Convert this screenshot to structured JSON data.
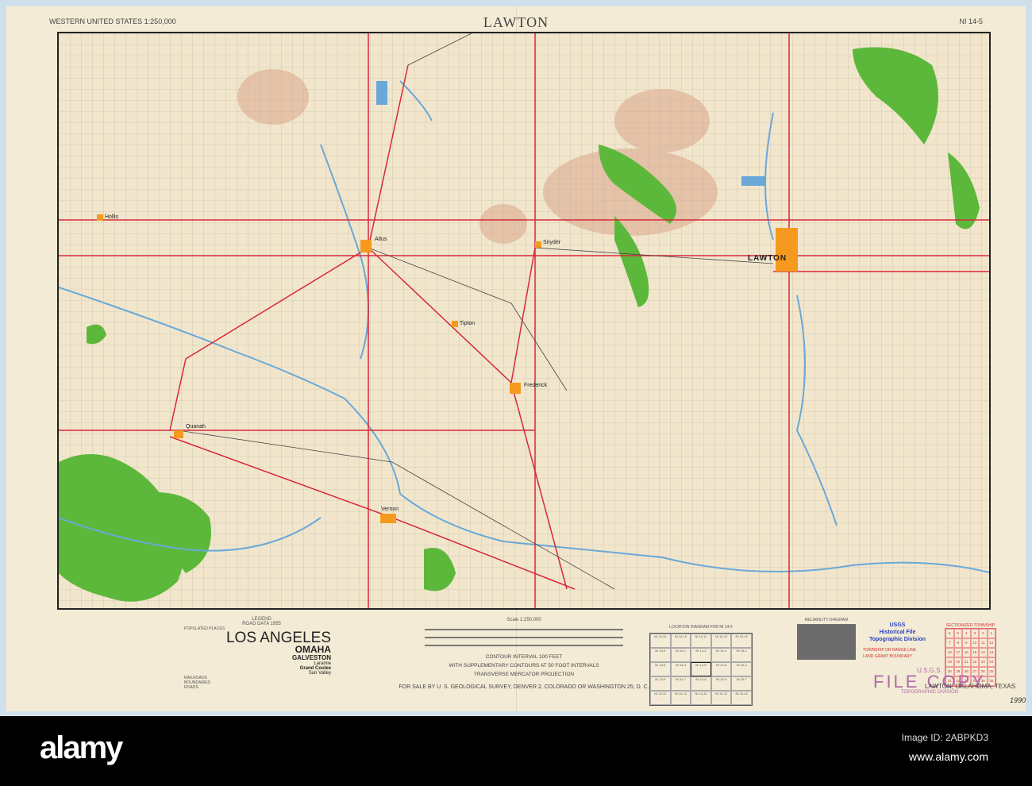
{
  "header": {
    "series": "WESTERN UNITED STATES 1:250,000",
    "title": "LAWTON",
    "sheet": "NI 14-5"
  },
  "map": {
    "cities": [
      {
        "name": "LAWTON",
        "major": true
      },
      {
        "name": "Altus"
      },
      {
        "name": "Frederick"
      },
      {
        "name": "Vernon"
      },
      {
        "name": "Tipton"
      },
      {
        "name": "Quanah"
      },
      {
        "name": "Hollis"
      },
      {
        "name": "Snyder"
      }
    ],
    "colors": {
      "vegetation": "#5cb83a",
      "urban": "#f59a1e",
      "road": "#d8283a",
      "water": "#6aa8d8",
      "contour": "#c98a6a",
      "grid": "#b9b0a0"
    }
  },
  "legend": {
    "title": "LEGEND",
    "subtitle": "ROAD DATA 1955",
    "populated_places": "POPULATED PLACES",
    "examples": [
      "LOS ANGELES",
      "OMAHA",
      "GALVESTON",
      "Laramie",
      "Grand Coulee",
      "Sun Valley"
    ],
    "railroads": "RAILROADS",
    "boundaries": "BOUNDARIES",
    "roads": "ROADS"
  },
  "scale": {
    "label": "Scale 1:250,000",
    "contour": "CONTOUR INTERVAL 100 FEET",
    "supplementary": "WITH SUPPLEMENTARY CONTOURS AT 50 FOOT INTERVALS",
    "projection": "TRANSVERSE MERCATOR PROJECTION",
    "sale": "FOR SALE BY U. S. GEOLOGICAL SURVEY, DENVER 2, COLORADO OR WASHINGTON 25, D. C."
  },
  "location_diagram": {
    "title": "LOCATION DIAGRAM FOR NI 14-5",
    "cells": [
      "NI 13-12",
      "NI 14-10",
      "NI 14-11",
      "NI 14-12",
      "NI 15-10",
      "NI 13-3",
      "NI 14-1",
      "NI 14-2",
      "NI 14-3",
      "NI 15-1",
      "NI 13-6",
      "NI 14-4",
      "NI 14-5",
      "NI 14-6",
      "NI 15-4",
      "NI 13-9",
      "NI 14-7",
      "NI 14-8",
      "NI 14-9",
      "NI 15-7",
      "NI 13-12",
      "NI 14-10",
      "NI 14-11",
      "NI 14-12",
      "NI 15-10"
    ]
  },
  "reliability": {
    "title": "RELIABILITY DIAGRAM"
  },
  "stamps": {
    "usgs_blue": [
      "USGS",
      "Historical File",
      "Topographic Division"
    ],
    "township_line": "TOWNSHIP OR RANGE LINE",
    "land_grant": "LAND GRANT BOUNDARY",
    "file_copy": [
      "U.S.G.S.",
      "FILE COPY",
      "TOPOGRAPHIC DIVISION"
    ],
    "year": "1990"
  },
  "sectionized": {
    "title": "SECTIONIZED TOWNSHIP",
    "numbers": [
      "6",
      "5",
      "4",
      "3",
      "2",
      "1",
      "7",
      "8",
      "9",
      "10",
      "11",
      "12",
      "18",
      "17",
      "16",
      "15",
      "14",
      "13",
      "19",
      "20",
      "21",
      "22",
      "23",
      "24",
      "30",
      "29",
      "28",
      "27",
      "26",
      "25",
      "31",
      "32",
      "33",
      "34",
      "35",
      "36"
    ]
  },
  "footer_location": "LAWTON, OKLAHOMA, TEXAS",
  "watermark": {
    "logo": "alamy",
    "image_id": "Image ID: 2ABPKD3",
    "url": "www.alamy.com"
  }
}
